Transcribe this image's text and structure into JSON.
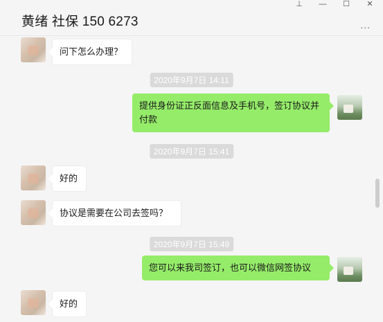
{
  "window": {
    "title": "黄绪 社保 150  6273",
    "controls": {
      "pin": "⊥",
      "minimize": "—",
      "maximize": "☐",
      "close": "✕"
    },
    "more": "..."
  },
  "messages": [
    {
      "type": "in",
      "text": "问下怎么办理？"
    },
    {
      "type": "time",
      "text": "2020年9月7日 14:11"
    },
    {
      "type": "out",
      "text": "提供身份证正反面信息及手机号，签订协议并付款"
    },
    {
      "type": "time",
      "text": "2020年9月7日 15:41"
    },
    {
      "type": "in",
      "text": "好的"
    },
    {
      "type": "in",
      "text": "协议是需要在公司去签吗？"
    },
    {
      "type": "time",
      "text": "2020年9月7日 15:49"
    },
    {
      "type": "out",
      "text": "您可以来我司签订，也可以微信网签协议"
    },
    {
      "type": "in",
      "text": "好的"
    }
  ],
  "colors": {
    "outgoing_bubble": "#95ec69",
    "incoming_bubble": "#ffffff",
    "background": "#f5f5f5",
    "timestamp_bg": "#dadada"
  }
}
